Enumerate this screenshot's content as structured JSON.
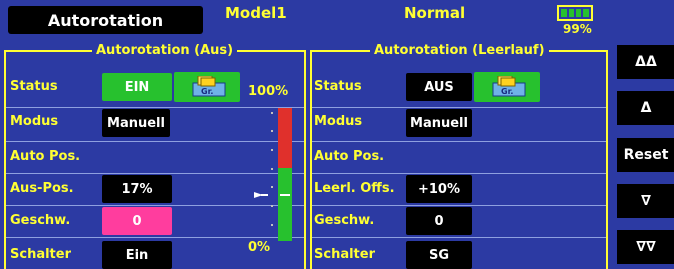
{
  "header": {
    "title": "Autorotation",
    "model": "Model1",
    "condition": "Normal",
    "battery_pct": "99%",
    "battery_level": 0.99
  },
  "left_panel": {
    "title": "Autorotation (Aus)",
    "rows": [
      {
        "label": "Status",
        "value": "EIN"
      },
      {
        "label": "Modus",
        "value": "Manuell"
      },
      {
        "label": "Auto Pos.",
        "value": ""
      },
      {
        "label": "Aus-Pos.",
        "value": "17%"
      },
      {
        "label": "Geschw.",
        "value": "0"
      },
      {
        "label": "Schalter",
        "value": "Ein"
      }
    ],
    "group_label": "Gr.",
    "scale_top": "100%",
    "scale_bottom": "0%",
    "indicator_position": 0.17
  },
  "right_panel": {
    "title": "Autorotation (Leerlauf)",
    "rows": [
      {
        "label": "Status",
        "value": "AUS"
      },
      {
        "label": "Modus",
        "value": "Manuell"
      },
      {
        "label": "Auto Pos.",
        "value": ""
      },
      {
        "label": "Leerl. Offs.",
        "value": "+10%"
      },
      {
        "label": "Geschw.",
        "value": "0"
      },
      {
        "label": "Schalter",
        "value": "SG"
      }
    ],
    "group_label": "Gr."
  },
  "side_buttons": [
    "ΔΔ",
    "Δ",
    "Reset",
    "∇",
    "∇∇"
  ],
  "colors": {
    "background": "#2c3aa3",
    "label": "#ffff33",
    "active_green": "#27c12e",
    "speed_pink": "#ff3d9e",
    "scale_red": "#e0302c"
  }
}
